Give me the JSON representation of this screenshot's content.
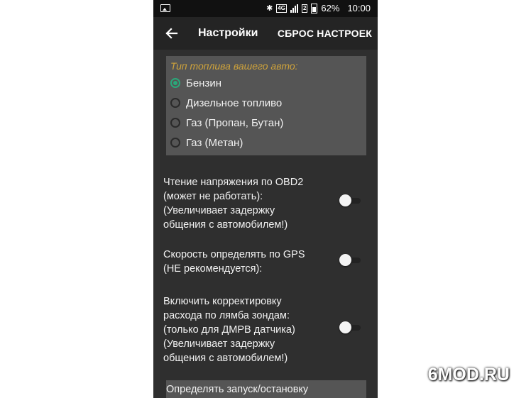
{
  "status_bar": {
    "battery": "62%",
    "time": "10:00",
    "network_badge": "4G",
    "sim_badge": "2",
    "icons": [
      "image-icon",
      "bluetooth-icon",
      "signal-icon",
      "battery-icon"
    ]
  },
  "app_bar": {
    "title": "Настройки",
    "reset_label": "СБРОС НАСТРОЕК",
    "back_icon": "arrow-left-icon"
  },
  "fuel": {
    "label": "Тип топлива вашего авто:",
    "options": [
      "Бензин",
      "Дизельное топливо",
      "Газ (Пропан, Бутан)",
      "Газ (Метан)"
    ],
    "selected": "Бензин"
  },
  "settings": [
    {
      "lines": [
        "Чтение напряжения по OBD2",
        "(может не работать):",
        "(Увеличивает задержку",
        "общения с автомобилем!)"
      ],
      "enabled": false
    },
    {
      "lines": [
        "Скорость определять по GPS",
        "(НЕ рекомендуется):"
      ],
      "enabled": false
    },
    {
      "lines": [
        "Включить корректировку",
        "расхода по лямба зондам:",
        "(только для ДМРВ датчика)",
        "(Увеличивает задержку",
        "общения с автомобилем!)"
      ],
      "enabled": false
    }
  ],
  "bottom_item": {
    "label": "Определять запуск/остановку"
  },
  "watermark": "6MOD.RU",
  "colors": {
    "accent": "#2aa87a",
    "label": "#cfa33b",
    "background": "#2f2f2f",
    "card": "#555555"
  }
}
